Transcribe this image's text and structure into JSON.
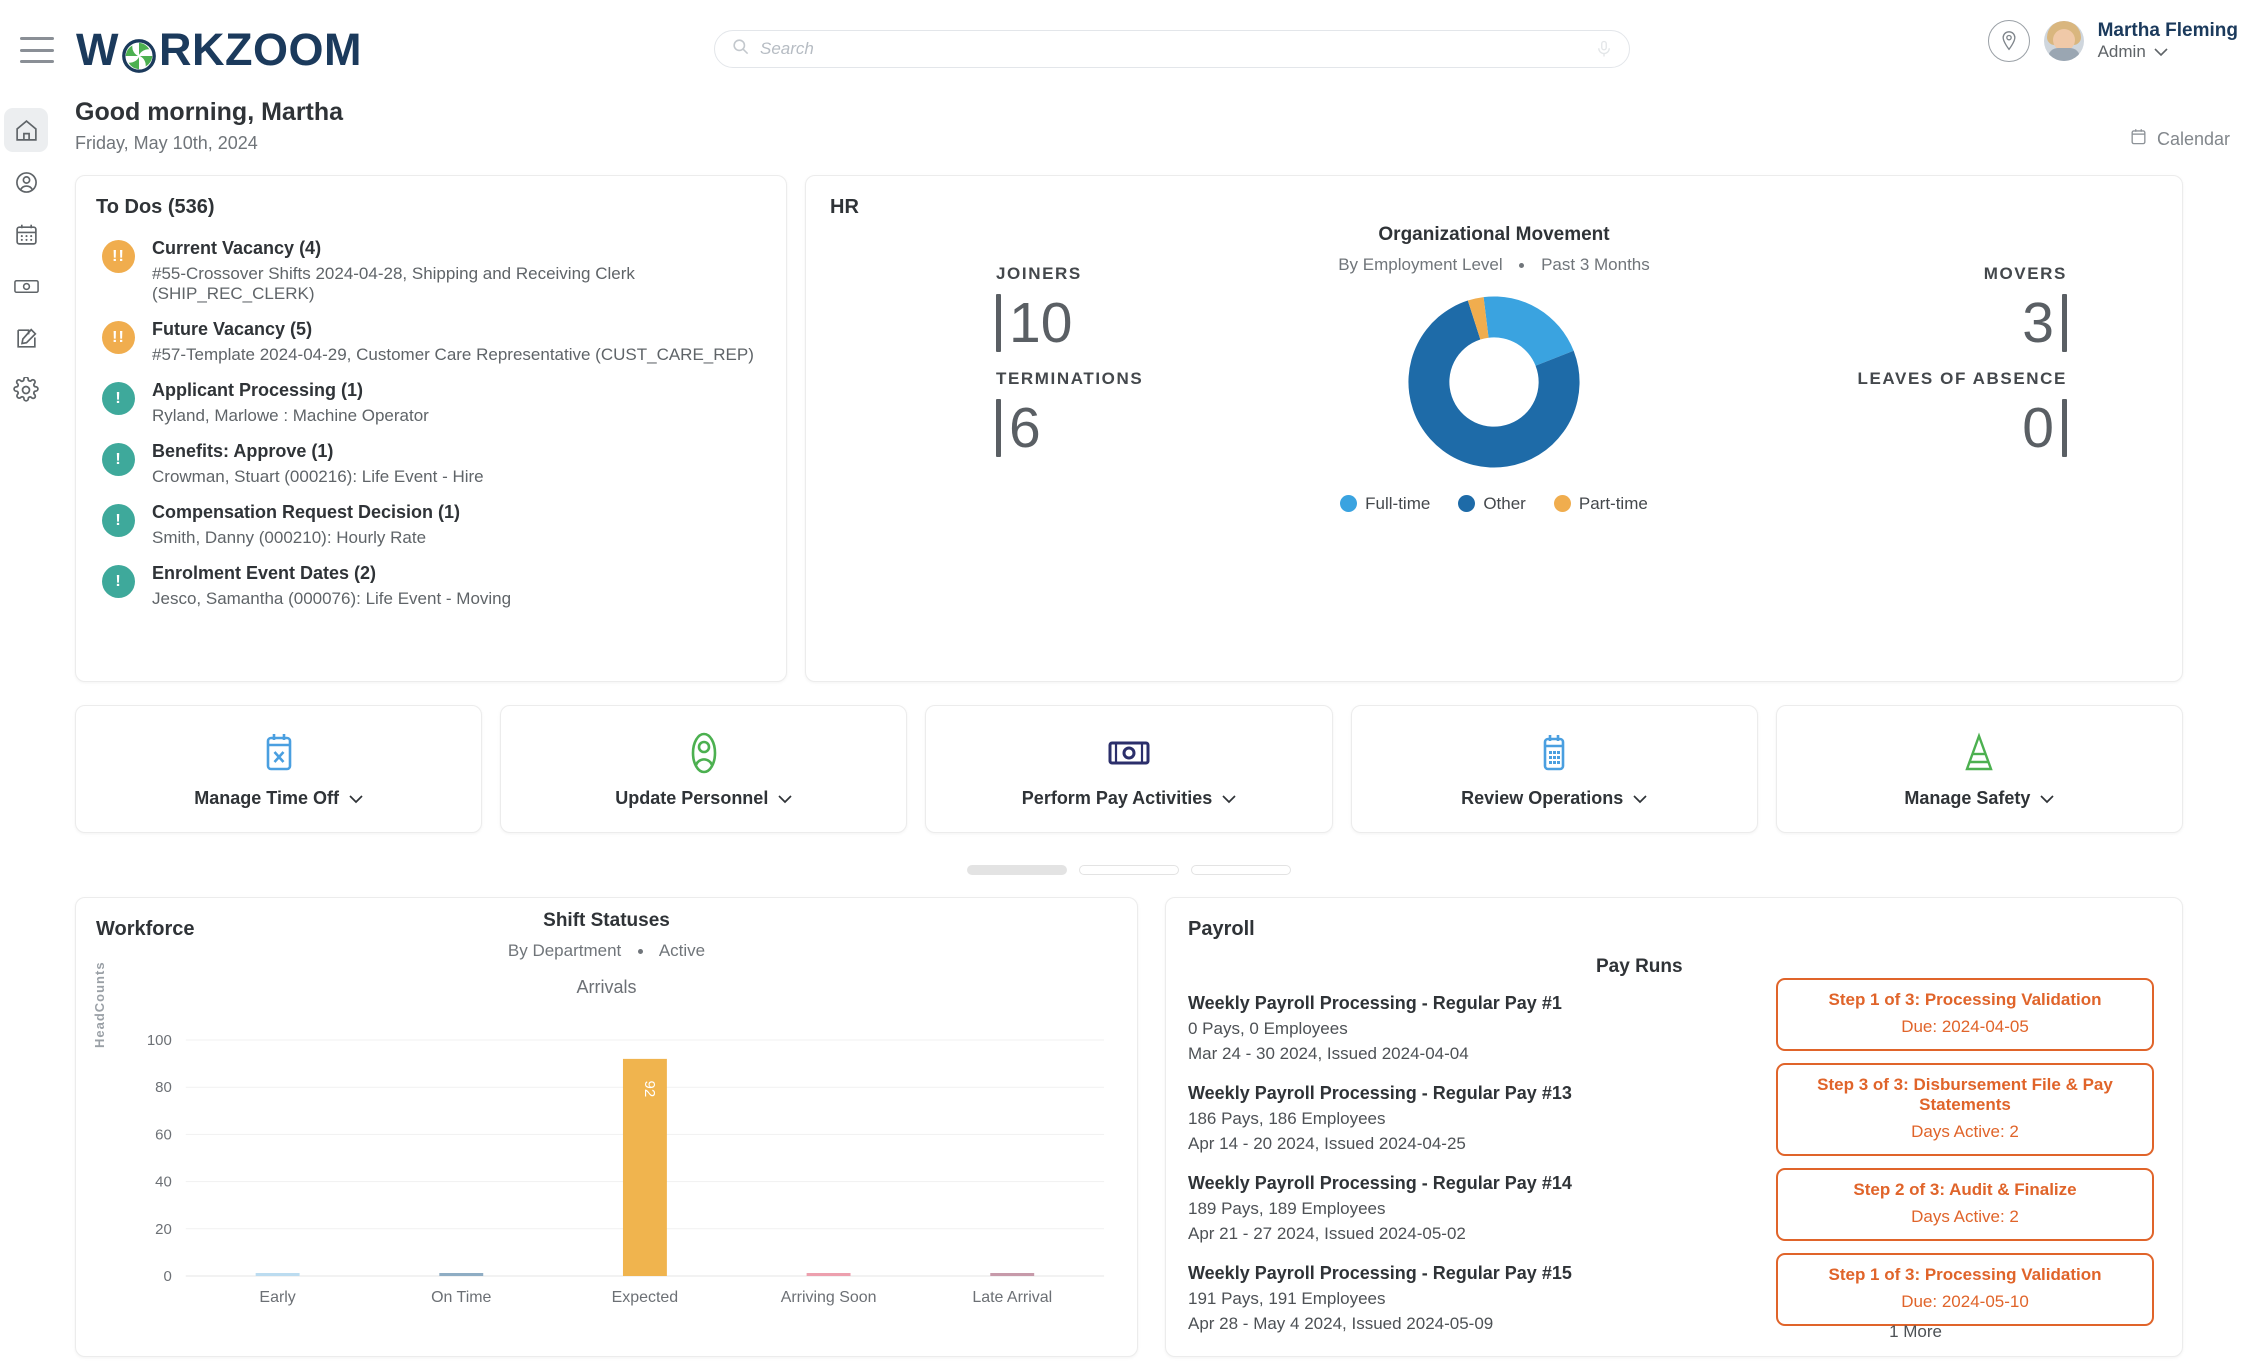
{
  "header": {
    "menu_icon": "hamburger-icon",
    "logo_text_left": "W",
    "logo_text_right": "RKZOOM",
    "search": {
      "placeholder": "Search",
      "value": "",
      "search_icon": "search-icon",
      "mic_icon": "microphone-icon"
    },
    "location_icon": "location-pin-icon",
    "user_name": "Martha Fleming",
    "user_role": "Admin",
    "user_caret": "chevron-down-icon"
  },
  "sidebar": {
    "items": [
      {
        "name": "home",
        "icon": "home-icon",
        "active": true
      },
      {
        "name": "people",
        "icon": "user-circle-icon",
        "active": false
      },
      {
        "name": "calendar",
        "icon": "calendar-icon",
        "active": false
      },
      {
        "name": "payroll",
        "icon": "money-bill-icon",
        "active": false
      },
      {
        "name": "forms",
        "icon": "edit-note-icon",
        "active": false
      },
      {
        "name": "settings",
        "icon": "gear-icon",
        "active": false
      }
    ]
  },
  "greeting": {
    "title": "Good morning, Martha",
    "date": "Friday, May 10th, 2024",
    "calendar_label": "Calendar",
    "calendar_icon": "calendar-icon"
  },
  "todos": {
    "title": "To Dos (536)",
    "items": [
      {
        "severity": "warn",
        "badge": "!!",
        "title": "Current Vacancy (4)",
        "detail": "#55-Crossover Shifts 2024-04-28, Shipping and Receiving Clerk (SHIP_REC_CLERK)"
      },
      {
        "severity": "warn",
        "badge": "!!",
        "title": "Future Vacancy (5)",
        "detail": "#57-Template 2024-04-29, Customer Care Representative (CUST_CARE_REP)"
      },
      {
        "severity": "info",
        "badge": "!",
        "title": "Applicant Processing (1)",
        "detail": "Ryland, Marlowe : Machine Operator"
      },
      {
        "severity": "info",
        "badge": "!",
        "title": "Benefits: Approve (1)",
        "detail": "Crowman, Stuart (000216): Life Event - Hire"
      },
      {
        "severity": "info",
        "badge": "!",
        "title": "Compensation Request Decision (1)",
        "detail": "Smith, Danny (000210): Hourly Rate"
      },
      {
        "severity": "info",
        "badge": "!",
        "title": "Enrolment Event Dates (2)",
        "detail": "Jesco, Samantha (000076): Life Event - Moving"
      }
    ]
  },
  "hr": {
    "title": "HR",
    "kpis": [
      {
        "label": "JOINERS",
        "value": "10",
        "side": "left"
      },
      {
        "label": "TERMINATIONS",
        "value": "6",
        "side": "left"
      },
      {
        "label": "MOVERS",
        "value": "3",
        "side": "right"
      },
      {
        "label": "LEAVES OF ABSENCE",
        "value": "0",
        "side": "right"
      }
    ]
  },
  "chart_data": [
    {
      "type": "pie",
      "title": "Organizational Movement",
      "subtitle_left": "By Employment Level",
      "subtitle_right": "Past 3 Months",
      "categories": [
        "Full-time",
        "Other",
        "Part-time"
      ],
      "values": [
        21,
        76,
        3
      ],
      "colors": [
        "#3aa3e0",
        "#1e6ba8",
        "#f0ad4e"
      ],
      "legend_position": "bottom",
      "donut": true
    },
    {
      "type": "bar",
      "title": "Shift Statuses",
      "subtitle_left": "By Department",
      "subtitle_right": "Active",
      "series_label": "Arrivals",
      "categories": [
        "Early",
        "On Time",
        "Expected",
        "Arriving Soon",
        "Late Arrival"
      ],
      "values": [
        0,
        0,
        92,
        0,
        0
      ],
      "bar_colors": [
        "#bcdcf0",
        "#8fadc4",
        "#f0b44e",
        "#eda0ae",
        "#c79aaa"
      ],
      "value_labels": [
        "",
        "",
        "92",
        "",
        ""
      ],
      "xlabel": "",
      "ylabel": "HeadCounts",
      "ylim": [
        0,
        100
      ],
      "yticks": [
        0,
        20,
        40,
        60,
        80,
        100
      ],
      "grid": true
    }
  ],
  "workforce": {
    "title": "Workforce"
  },
  "payroll": {
    "title": "Payroll",
    "pay_runs_title": "Pay Runs",
    "more_label": "1 More",
    "items": [
      {
        "title": "Weekly Payroll Processing - Regular Pay #1",
        "counts": "0 Pays, 0 Employees",
        "period": "Mar 24 - 30 2024, Issued 2024-04-04"
      },
      {
        "title": "Weekly Payroll Processing - Regular Pay #13",
        "counts": "186 Pays, 186 Employees",
        "period": "Apr 14 - 20 2024, Issued 2024-04-25"
      },
      {
        "title": "Weekly Payroll Processing - Regular Pay #14",
        "counts": "189 Pays, 189 Employees",
        "period": "Apr 21 - 27 2024, Issued 2024-05-02"
      },
      {
        "title": "Weekly Payroll Processing - Regular Pay #15",
        "counts": "191 Pays, 191 Employees",
        "period": "Apr 28 - May 4 2024, Issued 2024-05-09"
      }
    ],
    "steps": [
      {
        "title": "Step 1 of 3: Processing Validation",
        "sub": "Due: 2024-04-05"
      },
      {
        "title": "Step 3 of 3: Disbursement File & Pay Statements",
        "sub": "Days Active: 2"
      },
      {
        "title": "Step 2 of 3: Audit & Finalize",
        "sub": "Days Active: 2"
      },
      {
        "title": "Step 1 of 3: Processing Validation",
        "sub": "Due: 2024-05-10"
      }
    ]
  },
  "quick_actions": {
    "cards": [
      {
        "label": "Manage Time Off",
        "icon": "calendar-x-icon",
        "color": "#4a9fe0",
        "caret": "chevron-down-icon"
      },
      {
        "label": "Update Personnel",
        "icon": "person-icon",
        "color": "#4cb050",
        "caret": "chevron-down-icon"
      },
      {
        "label": "Perform Pay Activities",
        "icon": "money-bill-icon",
        "color": "#2b2f6b",
        "caret": "chevron-down-icon"
      },
      {
        "label": "Review Operations",
        "icon": "device-grid-icon",
        "color": "#4a9fe0",
        "caret": "chevron-down-icon"
      },
      {
        "label": "Manage Safety",
        "icon": "traffic-cone-icon",
        "color": "#4cb050",
        "caret": "chevron-down-icon"
      }
    ],
    "pager": [
      {
        "active": true
      },
      {
        "active": false
      },
      {
        "active": false
      }
    ]
  },
  "colors": {
    "brand_navy": "#1b3a5c",
    "brand_green": "#4cb050",
    "accent_orange": "#e0642a",
    "warn": "#f0ad4e",
    "info": "#3ea99b"
  }
}
